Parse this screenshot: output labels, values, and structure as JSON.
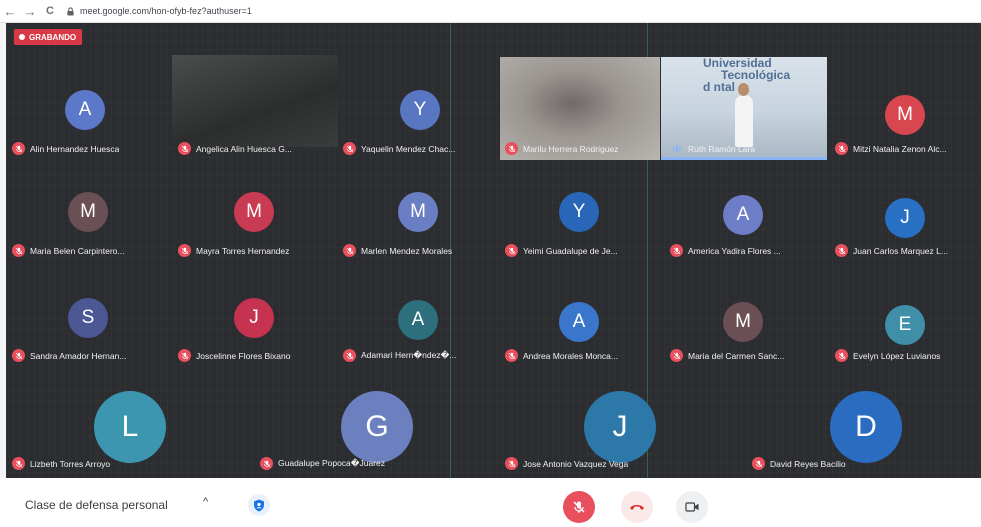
{
  "browser": {
    "url": "meet.google.com/hon-ofyb-fez?authuser=1",
    "back_icon": "←",
    "forward_icon": "→",
    "reload_icon": "C"
  },
  "recording": {
    "label": "GRABANDO",
    "color": "#d93846"
  },
  "participants": [
    {
      "name": "Alin Hernandez Huesca",
      "initial": "A",
      "color": "#5b79c8"
    },
    {
      "name": "Angelica Alin Huesca G...",
      "initial": "",
      "color": "#3d3f3f",
      "video": true
    },
    {
      "name": "Yaquelin Mendez Chac...",
      "initial": "Y",
      "color": "#5876c2"
    },
    {
      "name": "Marilu Herrera Rodriguez",
      "initial": "",
      "color": "#8f8a87",
      "video": true
    },
    {
      "name": "Ruth Ramón Lara",
      "initial": "",
      "color": "#c9d6e4",
      "video": true,
      "speaking": true
    },
    {
      "name": "Mitzi Natalia Zenon Alc...",
      "initial": "M",
      "color": "#d8474f"
    },
    {
      "name": "Maria Belen Carpintero...",
      "initial": "M",
      "color": "#6a4f55"
    },
    {
      "name": "Mayra Torres Hernandez",
      "initial": "M",
      "color": "#c83b52"
    },
    {
      "name": "Marlen Mendez Morales",
      "initial": "M",
      "color": "#6a7ec4"
    },
    {
      "name": "Yeimi Guadalupe de Je...",
      "initial": "Y",
      "color": "#2966b8"
    },
    {
      "name": "America Yadira Flores ...",
      "initial": "A",
      "color": "#6e7dc7"
    },
    {
      "name": "Juan Carlos Marquez L...",
      "initial": "J",
      "color": "#2770c4"
    },
    {
      "name": "Sandra Amador Hernan...",
      "initial": "S",
      "color": "#4b5894"
    },
    {
      "name": "Joscelinne Flores Bixano",
      "initial": "J",
      "color": "#c63350"
    },
    {
      "name": "Adamari Hern�ndez�...",
      "initial": "A",
      "color": "#2d6f7c"
    },
    {
      "name": "Andrea Morales Monca...",
      "initial": "A",
      "color": "#3a77cc"
    },
    {
      "name": "Maria del Carmen Sanc...",
      "initial": "M",
      "color": "#6b4f55"
    },
    {
      "name": "Evelyn López Luvianos",
      "initial": "E",
      "color": "#3f8fa8"
    },
    {
      "name": "Lizbeth Torres Arroyo",
      "initial": "L",
      "color": "#3d96b0"
    },
    {
      "name": "Guadalupe Popoca�Juarez",
      "initial": "G",
      "color": "#6c7fbe"
    },
    {
      "name": "Jose Antonio Vazquez Vega",
      "initial": "J",
      "color": "#2c78a8"
    },
    {
      "name": "David Reyes Bacilio",
      "initial": "D",
      "color": "#2a6cc0"
    }
  ],
  "video_text": {
    "sign_line1": "Universidad",
    "sign_line2": "Tecnológica",
    "sign_line3": "d   ntal"
  },
  "bottom": {
    "meeting_name": "Clase de defensa personal",
    "caret": "^",
    "mic_color": "#e8505d",
    "end_call_color": "#d93025"
  }
}
